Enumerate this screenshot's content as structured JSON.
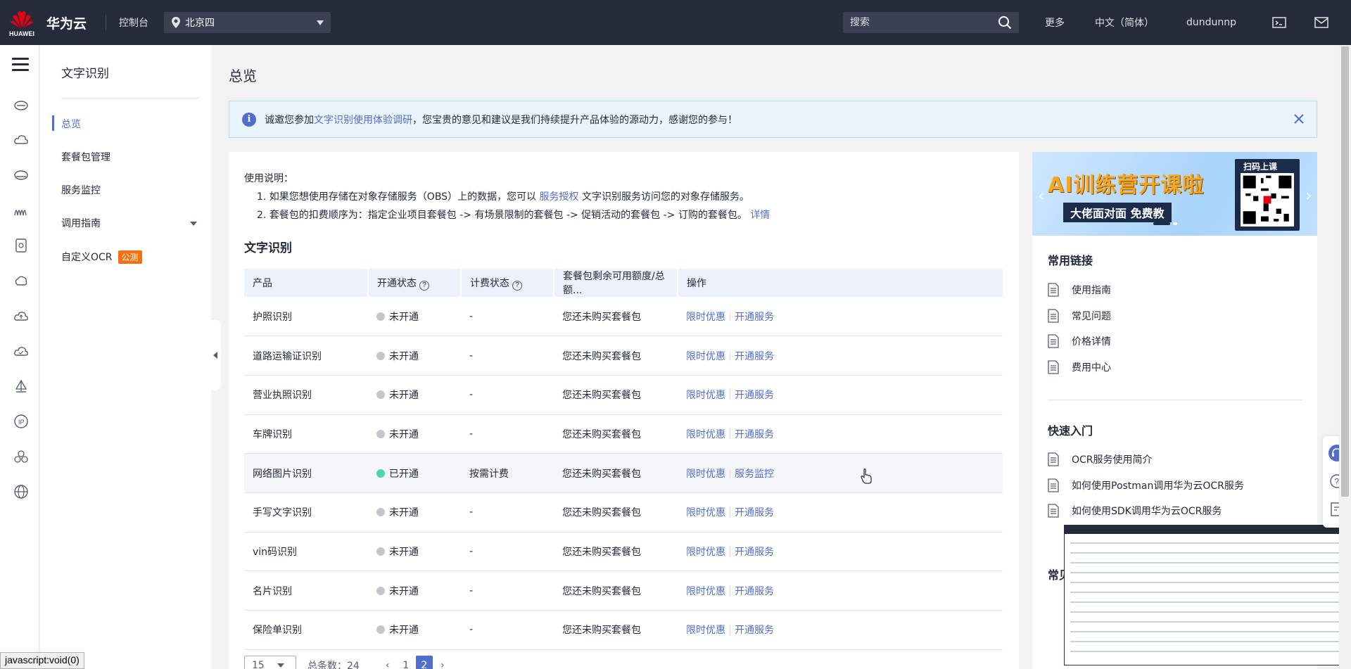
{
  "header": {
    "brand_logo_text": "HUAWEI",
    "brand": "华为云",
    "console": "控制台",
    "region": "北京四",
    "search_placeholder": "搜索",
    "more": "更多",
    "language": "中文（简体）",
    "user": "dundunnp"
  },
  "subnav": {
    "title": "文字识别",
    "items": [
      {
        "label": "总览"
      },
      {
        "label": "套餐包管理"
      },
      {
        "label": "服务监控"
      },
      {
        "label": "调用指南"
      },
      {
        "label": "自定义OCR",
        "badge": "公测"
      }
    ]
  },
  "page": {
    "title": "总览",
    "notice": {
      "prefix": "诚邀您参加",
      "link": "文字识别使用体验调研",
      "suffix": "，您宝贵的意见和建议是我们持续提升产品体验的源动力，感谢您的参与！"
    },
    "usage": {
      "heading": "使用说明：",
      "line1_prefix": "1. 如果您想使用存储在对象存储服务（OBS）上的数据，您可以",
      "line1_link": "服务授权",
      "line1_suffix": "文字识别服务访问您的对象存储服务。",
      "line2_prefix": "2. 套餐包的扣费顺序为：指定企业项目套餐包 -> 有场景限制的套餐包 -> 促销活动的套餐包 -> 订购的套餐包。",
      "line2_link": "详情"
    },
    "section_title": "文字识别",
    "table": {
      "headers": [
        "产品",
        "开通状态",
        "计费状态",
        "套餐包剩余可用额度/总额...",
        "操作"
      ],
      "rows": [
        {
          "product": "护照识别",
          "status": "未开通",
          "billing": "-",
          "quota": "您还未购买套餐包",
          "op1": "限时优惠",
          "op2": "开通服务",
          "on": false
        },
        {
          "product": "道路运输证识别",
          "status": "未开通",
          "billing": "-",
          "quota": "您还未购买套餐包",
          "op1": "限时优惠",
          "op2": "开通服务",
          "on": false
        },
        {
          "product": "营业执照识别",
          "status": "未开通",
          "billing": "-",
          "quota": "您还未购买套餐包",
          "op1": "限时优惠",
          "op2": "开通服务",
          "on": false
        },
        {
          "product": "车牌识别",
          "status": "未开通",
          "billing": "-",
          "quota": "您还未购买套餐包",
          "op1": "限时优惠",
          "op2": "开通服务",
          "on": false
        },
        {
          "product": "网络图片识别",
          "status": "已开通",
          "billing": "按需计费",
          "quota": "您还未购买套餐包",
          "op1": "限时优惠",
          "op2": "服务监控",
          "on": true
        },
        {
          "product": "手写文字识别",
          "status": "未开通",
          "billing": "-",
          "quota": "您还未购买套餐包",
          "op1": "限时优惠",
          "op2": "开通服务",
          "on": false
        },
        {
          "product": "vin码识别",
          "status": "未开通",
          "billing": "-",
          "quota": "您还未购买套餐包",
          "op1": "限时优惠",
          "op2": "开通服务",
          "on": false
        },
        {
          "product": "名片识别",
          "status": "未开通",
          "billing": "-",
          "quota": "您还未购买套餐包",
          "op1": "限时优惠",
          "op2": "开通服务",
          "on": false
        },
        {
          "product": "保险单识别",
          "status": "未开通",
          "billing": "-",
          "quota": "您还未购买套餐包",
          "op1": "限时优惠",
          "op2": "开通服务",
          "on": false
        }
      ]
    },
    "pager": {
      "page_size": "15",
      "total": "总条数：24",
      "pages": [
        "1",
        "2"
      ],
      "current": "2"
    }
  },
  "right": {
    "banner": {
      "headline": "AI训练营开课啦",
      "sub": "大佬面对面 免费教",
      "scan": "扫码上课"
    },
    "common_links_title": "常用链接",
    "common_links": [
      "使用指南",
      "常见问题",
      "价格详情",
      "费用中心"
    ],
    "quick_start_title": "快速入门",
    "quick_start": [
      "OCR服务使用简介",
      "如何使用Postman调用华为云OCR服务",
      "如何使用SDK调用华为云OCR服务"
    ],
    "partial_title": "常见"
  },
  "status_bar": "javascript:void(0)",
  "colors": {
    "topbar": "#252b3a",
    "link": "#526ecc",
    "badge": "#f66f11",
    "on_dot": "#50d4ab"
  }
}
